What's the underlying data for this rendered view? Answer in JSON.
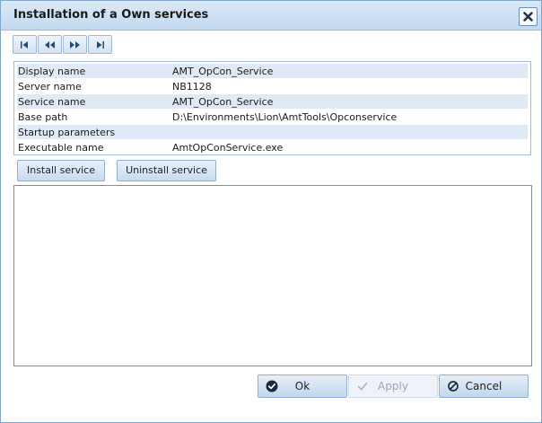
{
  "dialog": {
    "title": "Installation of a Own services",
    "close_icon": "close-icon"
  },
  "nav": [
    {
      "name": "first-record-icon"
    },
    {
      "name": "previous-record-icon"
    },
    {
      "name": "next-record-icon"
    },
    {
      "name": "last-record-icon"
    }
  ],
  "properties": [
    {
      "label": "Display name",
      "value": "AMT_OpCon_Service"
    },
    {
      "label": "Server name",
      "value": "NB1128"
    },
    {
      "label": "Service name",
      "value": "AMT_OpCon_Service"
    },
    {
      "label": "Base path",
      "value": "D:\\Environments\\Lion\\AmtTools\\Opconservice"
    },
    {
      "label": "Startup parameters",
      "value": ""
    },
    {
      "label": "Executable name",
      "value": "AmtOpConService.exe"
    }
  ],
  "actions": {
    "install_label": "Install service",
    "uninstall_label": "Uninstall service"
  },
  "log": {
    "text": ""
  },
  "footer": {
    "ok_label": "Ok",
    "apply_label": "Apply",
    "cancel_label": "Cancel",
    "apply_enabled": false
  },
  "colors": {
    "titlebar": "#c2d9f0",
    "row_alt": "#dfeaf6",
    "border": "#9cbde0"
  }
}
